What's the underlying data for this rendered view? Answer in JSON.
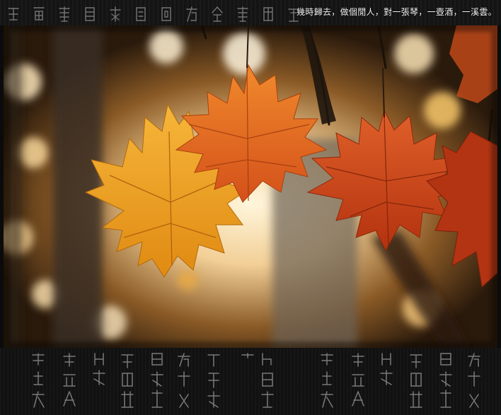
{
  "header": {
    "tagline": "幾時歸去，做個閒人，對一張琴，一壺酒，一溪雲。"
  },
  "photo": {
    "subject": "maple-leaves-photo",
    "colors": {
      "background": "#1a1208",
      "glow": "#fff3d6",
      "leaf_gold": "#f0a21e",
      "leaf_orange": "#e5641b",
      "leaf_red": "#c23b14",
      "trunk": "#3a3027"
    }
  },
  "decor": {
    "band_color": "#111111",
    "glyph_color": "#bdbdbd"
  }
}
